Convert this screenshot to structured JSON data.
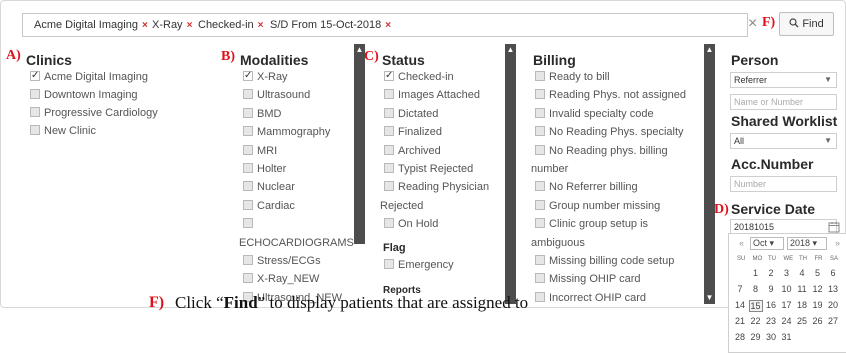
{
  "filters": {
    "tags": [
      {
        "label": "Acme Digital Imaging",
        "remove": "×"
      },
      {
        "label": "X-Ray",
        "remove": "×"
      },
      {
        "label": "Checked-in",
        "remove": "×"
      },
      {
        "label": "S/D From 15-Oct-2018",
        "remove": "×"
      }
    ],
    "clear_icon": "×",
    "find_label": "Find"
  },
  "callouts": {
    "a": "A)",
    "b": "B)",
    "c": "C)",
    "d": "D)",
    "f": "F)",
    "f2": "F)"
  },
  "clinics": {
    "title": "Clinics",
    "items": [
      {
        "label": "Acme Digital Imaging",
        "checked": true
      },
      {
        "label": "Downtown Imaging",
        "checked": false
      },
      {
        "label": "Progressive Cardiology",
        "checked": false
      },
      {
        "label": "New Clinic",
        "checked": false
      }
    ]
  },
  "modalities": {
    "title": "Modalities",
    "items": [
      {
        "label": "X-Ray",
        "checked": true
      },
      {
        "label": "Ultrasound",
        "checked": false
      },
      {
        "label": "BMD",
        "checked": false
      },
      {
        "label": "Mammography",
        "checked": false
      },
      {
        "label": "MRI",
        "checked": false
      },
      {
        "label": "Holter",
        "checked": false
      },
      {
        "label": "Nuclear",
        "checked": false
      },
      {
        "label": "Cardiac",
        "checked": false
      },
      {
        "label": "",
        "checked": false
      },
      {
        "label": "ECHOCARDIOGRAMS",
        "checked": false
      },
      {
        "label": "Stress/ECGs",
        "checked": false
      },
      {
        "label": "X-Ray_NEW",
        "checked": false
      },
      {
        "label": "Ultrasound_NEW",
        "checked": false
      }
    ]
  },
  "status": {
    "title": "Status",
    "items": [
      {
        "label": "Checked-in",
        "checked": true
      },
      {
        "label": "Images Attached",
        "checked": false
      },
      {
        "label": "Dictated",
        "checked": false
      },
      {
        "label": "Finalized",
        "checked": false
      },
      {
        "label": "Archived",
        "checked": false
      },
      {
        "label": "Typist Rejected",
        "checked": false
      },
      {
        "label": "Reading Physician",
        "checked": false
      },
      {
        "label": "Rejected",
        "checked": false
      },
      {
        "label": "On Hold",
        "checked": false
      }
    ],
    "flag_title": "Flag",
    "flag_items": [
      {
        "label": "Emergency",
        "checked": false
      }
    ],
    "reports_title": "Reports"
  },
  "billing": {
    "title": "Billing",
    "items": [
      {
        "label": "Ready to bill",
        "checked": false
      },
      {
        "label": "Reading Phys. not assigned",
        "checked": false
      },
      {
        "label": "Invalid specialty code",
        "checked": false
      },
      {
        "label": "No Reading Phys. specialty",
        "checked": false
      },
      {
        "label": "No Reading phys. billing",
        "checked": false
      },
      {
        "label": "number",
        "checked": false
      },
      {
        "label": "No Referrer billing",
        "checked": false
      },
      {
        "label": "Group number missing",
        "checked": false
      },
      {
        "label": "Clinic group setup is",
        "checked": false
      },
      {
        "label": "ambiguous",
        "checked": false
      },
      {
        "label": "Missing billing code setup",
        "checked": false
      },
      {
        "label": "Missing OHIP card",
        "checked": false
      },
      {
        "label": "Incorrect OHIP card",
        "checked": false
      }
    ]
  },
  "person": {
    "title": "Person",
    "select_value": "Referrer",
    "input_placeholder": "Name or Number"
  },
  "shared_worklist": {
    "title": "Shared Worklist",
    "select_value": "All"
  },
  "acc_number": {
    "title": "Acc.Number",
    "input_placeholder": "Number"
  },
  "service_date": {
    "title": "Service Date",
    "value": "20181015",
    "calendar_icon": "calendar-icon"
  },
  "calendar": {
    "prev": "«",
    "next": "»",
    "month": "Oct",
    "year": "2018",
    "dow": [
      "SU",
      "MO",
      "TU",
      "WE",
      "TH",
      "FR",
      "SA"
    ],
    "weeks": [
      [
        "",
        "1",
        "2",
        "3",
        "4",
        "5",
        "6"
      ],
      [
        "7",
        "8",
        "9",
        "10",
        "11",
        "12",
        "13"
      ],
      [
        "14",
        "15",
        "16",
        "17",
        "18",
        "19",
        "20"
      ],
      [
        "21",
        "22",
        "23",
        "24",
        "25",
        "26",
        "27"
      ],
      [
        "28",
        "29",
        "30",
        "31",
        "",
        "",
        ""
      ]
    ],
    "selected": "15"
  },
  "caption": {
    "pre": "Click “",
    "find": "Find",
    "post": "” to display patients that are assigned to"
  }
}
